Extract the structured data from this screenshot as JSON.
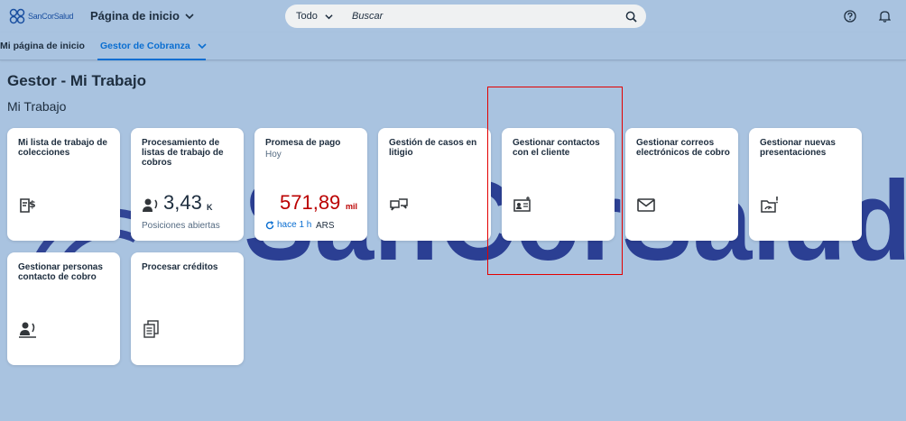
{
  "shell": {
    "logo_text": "SanCorSalud",
    "app_title": "Página de inicio",
    "search_scope": "Todo",
    "search_placeholder": "Buscar"
  },
  "tabs": [
    {
      "label": "Mi página de inicio",
      "active": false
    },
    {
      "label": "Gestor de Cobranza",
      "active": true
    }
  ],
  "page_title": "Gestor - Mi Trabajo",
  "section_title": "Mi Trabajo",
  "watermark_text": "SanCorSalud",
  "tiles": [
    {
      "title": "Mi lista de trabajo de colecciones",
      "icon": "money-document-icon"
    },
    {
      "title": "Procesamiento de listas de trabajo de cobros",
      "icon": "contact-phone-icon",
      "kpi_value": "3,43",
      "kpi_unit": "K",
      "footer": "Posiciones abiertas"
    },
    {
      "title": "Promesa de pago",
      "subtitle": "Hoy",
      "kpi_value": "571,89",
      "kpi_unit": "mil",
      "refresh": "hace 1 h",
      "currency": "ARS",
      "kpi_color": "#bb0000"
    },
    {
      "title": "Gestión de casos en litigio",
      "icon": "discussion-icon"
    },
    {
      "title": "Gestionar contactos con el cliente",
      "icon": "contact-card-icon"
    },
    {
      "title": "Gestionar correos electrónicos de cobro",
      "icon": "email-icon"
    },
    {
      "title": "Gestionar nuevas presentaciones",
      "icon": "folder-alert-icon"
    },
    {
      "title": "Gestionar personas contacto de cobro",
      "icon": "contact-phone-icon"
    },
    {
      "title": "Procesar créditos",
      "icon": "documents-icon"
    }
  ],
  "colors": {
    "background": "#a9c3e0",
    "accent": "#0a6ed1",
    "highlight": "#e30000",
    "kpi_negative": "#bb0000",
    "watermark": "#283e8f"
  }
}
